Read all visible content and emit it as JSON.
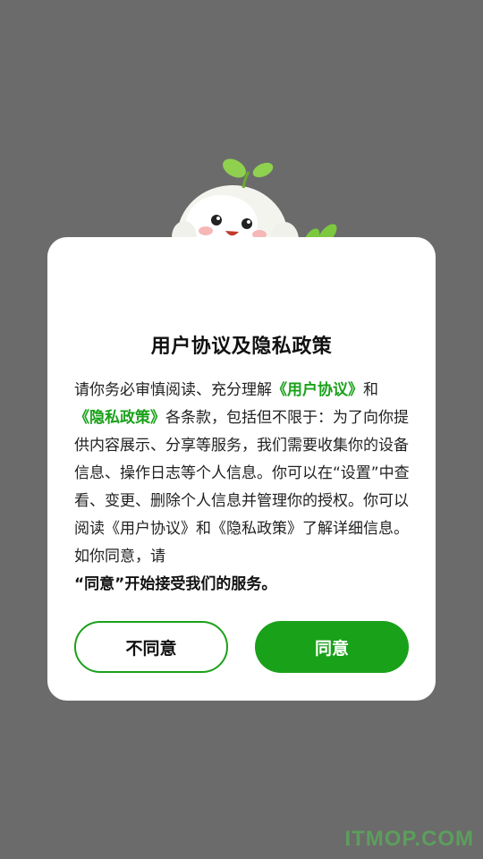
{
  "dialog": {
    "title": "用户协议及隐私政策",
    "body": {
      "p1": "请你务必审慎阅读、充分理解",
      "link_user_agreement": "《用户协议》",
      "p2": "和",
      "link_privacy_policy": "《隐私政策》",
      "p3": "各条款，包括但不限于：为了向你提供内容展示、分享等服务，我们需要收集你的设备信息、操作日志等个人信息。你可以在“设置”中查看、变更、删除个人信息并管理你的授权。你可以阅读《用户协议》和《隐私政策》了解详细信息。如你同意，请",
      "p4_bold": "“同意”开始接受我们的服务。"
    },
    "buttons": {
      "disagree": "不同意",
      "agree": "同意"
    }
  },
  "watermark": "ITMOP.COM",
  "colors": {
    "accent": "#1aa11a",
    "overlay": "#6b6b6b"
  }
}
